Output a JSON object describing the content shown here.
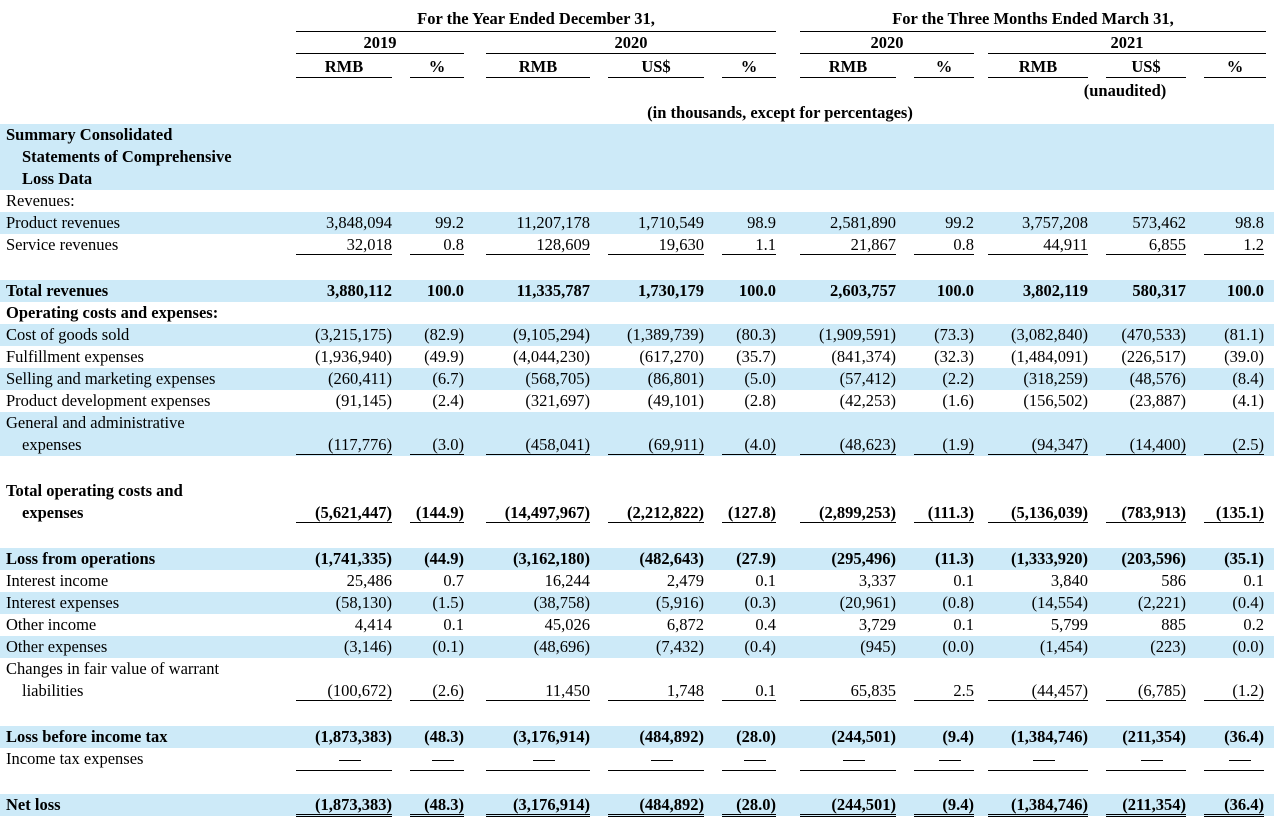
{
  "header": {
    "group1_title": "For the Year Ended December 31,",
    "group2_title": "For the Three Months Ended March 31,",
    "years": [
      "2019",
      "2020",
      "2020",
      "2021"
    ],
    "columns": [
      "RMB",
      "%",
      "RMB",
      "US$",
      "%",
      "RMB",
      "%",
      "RMB",
      "US$",
      "%"
    ],
    "unaudited": "(unaudited)",
    "units_note": "(in thousands, except for percentages)"
  },
  "section": {
    "line1": "Summary Consolidated",
    "line2": "Statements of Comprehensive",
    "line3": "Loss Data"
  },
  "rows": [
    {
      "label": "Revenues:",
      "values": []
    },
    {
      "label": "Product revenues",
      "values": [
        "3,848,094",
        "99.2",
        "11,207,178",
        "1,710,549",
        "98.9",
        "2,581,890",
        "99.2",
        "3,757,208",
        "573,462",
        "98.8"
      ]
    },
    {
      "label": "Service revenues",
      "values": [
        "32,018",
        "0.8",
        "128,609",
        "19,630",
        "1.1",
        "21,867",
        "0.8",
        "44,911",
        "6,855",
        "1.2"
      ]
    },
    {
      "label": "Total revenues",
      "values": [
        "3,880,112",
        "100.0",
        "11,335,787",
        "1,730,179",
        "100.0",
        "2,603,757",
        "100.0",
        "3,802,119",
        "580,317",
        "100.0"
      ]
    },
    {
      "label": "Operating costs and expenses:",
      "values": []
    },
    {
      "label": "Cost of goods sold",
      "values": [
        "(3,215,175)",
        "(82.9)",
        "(9,105,294)",
        "(1,389,739)",
        "(80.3)",
        "(1,909,591)",
        "(73.3)",
        "(3,082,840)",
        "(470,533)",
        "(81.1)"
      ]
    },
    {
      "label": "Fulfillment expenses",
      "values": [
        "(1,936,940)",
        "(49.9)",
        "(4,044,230)",
        "(617,270)",
        "(35.7)",
        "(841,374)",
        "(32.3)",
        "(1,484,091)",
        "(226,517)",
        "(39.0)"
      ]
    },
    {
      "label": "Selling and marketing expenses",
      "values": [
        "(260,411)",
        "(6.7)",
        "(568,705)",
        "(86,801)",
        "(5.0)",
        "(57,412)",
        "(2.2)",
        "(318,259)",
        "(48,576)",
        "(8.4)"
      ]
    },
    {
      "label": "Product development expenses",
      "values": [
        "(91,145)",
        "(2.4)",
        "(321,697)",
        "(49,101)",
        "(2.8)",
        "(42,253)",
        "(1.6)",
        "(156,502)",
        "(23,887)",
        "(4.1)"
      ]
    },
    {
      "label": "General and administrative",
      "label2": "expenses",
      "values": [
        "(117,776)",
        "(3.0)",
        "(458,041)",
        "(69,911)",
        "(4.0)",
        "(48,623)",
        "(1.9)",
        "(94,347)",
        "(14,400)",
        "(2.5)"
      ]
    },
    {
      "label": "Total operating costs and",
      "label2": "expenses",
      "values": [
        "(5,621,447)",
        "(144.9)",
        "(14,497,967)",
        "(2,212,822)",
        "(127.8)",
        "(2,899,253)",
        "(111.3)",
        "(5,136,039)",
        "(783,913)",
        "(135.1)"
      ]
    },
    {
      "label": "Loss from operations",
      "values": [
        "(1,741,335)",
        "(44.9)",
        "(3,162,180)",
        "(482,643)",
        "(27.9)",
        "(295,496)",
        "(11.3)",
        "(1,333,920)",
        "(203,596)",
        "(35.1)"
      ]
    },
    {
      "label": "Interest income",
      "values": [
        "25,486",
        "0.7",
        "16,244",
        "2,479",
        "0.1",
        "3,337",
        "0.1",
        "3,840",
        "586",
        "0.1"
      ]
    },
    {
      "label": "Interest expenses",
      "values": [
        "(58,130)",
        "(1.5)",
        "(38,758)",
        "(5,916)",
        "(0.3)",
        "(20,961)",
        "(0.8)",
        "(14,554)",
        "(2,221)",
        "(0.4)"
      ]
    },
    {
      "label": "Other income",
      "values": [
        "4,414",
        "0.1",
        "45,026",
        "6,872",
        "0.4",
        "3,729",
        "0.1",
        "5,799",
        "885",
        "0.2"
      ]
    },
    {
      "label": "Other expenses",
      "values": [
        "(3,146)",
        "(0.1)",
        "(48,696)",
        "(7,432)",
        "(0.4)",
        "(945)",
        "(0.0)",
        "(1,454)",
        "(223)",
        "(0.0)"
      ]
    },
    {
      "label": "Changes in fair value of warrant",
      "label2": "liabilities",
      "values": [
        "(100,672)",
        "(2.6)",
        "11,450",
        "1,748",
        "0.1",
        "65,835",
        "2.5",
        "(44,457)",
        "(6,785)",
        "(1.2)"
      ]
    },
    {
      "label": "Loss before income tax",
      "values": [
        "(1,873,383)",
        "(48.3)",
        "(3,176,914)",
        "(484,892)",
        "(28.0)",
        "(244,501)",
        "(9.4)",
        "(1,384,746)",
        "(211,354)",
        "(36.4)"
      ]
    },
    {
      "label": "Income tax expenses",
      "values": [
        "—",
        "—",
        "—",
        "—",
        "—",
        "—",
        "—",
        "—",
        "—",
        "—"
      ]
    },
    {
      "label": "Net loss",
      "values": [
        "(1,873,383)",
        "(48.3)",
        "(3,176,914)",
        "(484,892)",
        "(28.0)",
        "(244,501)",
        "(9.4)",
        "(1,384,746)",
        "(211,354)",
        "(36.4)"
      ]
    }
  ]
}
